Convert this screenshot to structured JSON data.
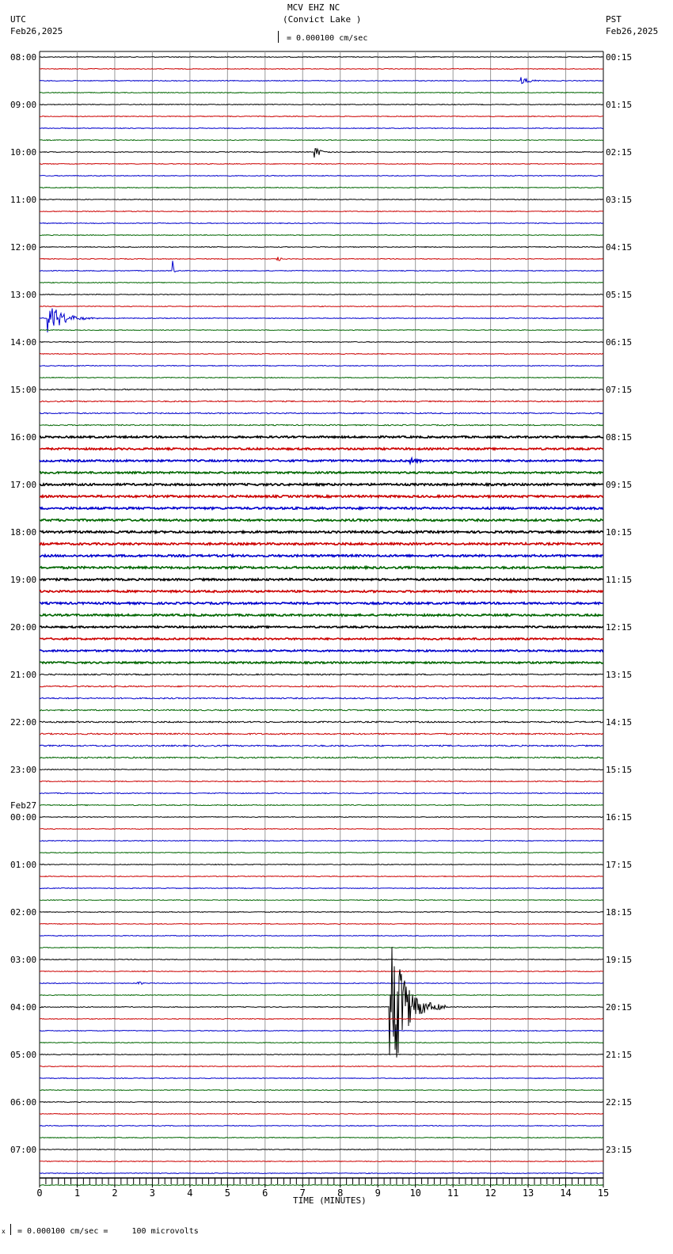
{
  "header": {
    "station": "MCV EHZ NC",
    "location": "(Convict Lake )",
    "scale": "= 0.000100 cm/sec",
    "left_tz": "UTC",
    "left_date": "Feb26,2025",
    "right_tz": "PST",
    "right_date": "Feb26,2025"
  },
  "footer": {
    "scale_note": "= 0.000100 cm/sec =     100 microvolts",
    "prefix": "x"
  },
  "chart_data": {
    "type": "line",
    "title": "MCV EHZ NC (Convict Lake )",
    "xlabel": "TIME (MINUTES)",
    "xlim": [
      0,
      15
    ],
    "x_ticks": [
      "0",
      "1",
      "2",
      "3",
      "4",
      "5",
      "6",
      "7",
      "8",
      "9",
      "10",
      "11",
      "12",
      "13",
      "14",
      "15"
    ],
    "traces_per_hour": 4,
    "trace_colors": [
      "#000000",
      "#cc0000",
      "#0000cc",
      "#006600"
    ],
    "left_labels": [
      "08:00",
      "09:00",
      "10:00",
      "11:00",
      "12:00",
      "13:00",
      "14:00",
      "15:00",
      "16:00",
      "17:00",
      "18:00",
      "19:00",
      "20:00",
      "21:00",
      "22:00",
      "23:00",
      "00:00",
      "01:00",
      "02:00",
      "03:00",
      "04:00",
      "05:00",
      "06:00",
      "07:00"
    ],
    "date_change_label": "Feb27",
    "right_labels": [
      "00:15",
      "01:15",
      "02:15",
      "03:15",
      "04:15",
      "05:15",
      "06:15",
      "07:15",
      "08:15",
      "09:15",
      "10:15",
      "11:15",
      "12:15",
      "13:15",
      "14:15",
      "15:15",
      "16:15",
      "17:15",
      "18:15",
      "19:15",
      "20:15",
      "21:15",
      "22:15",
      "23:15"
    ],
    "noise_by_hour": [
      0.6,
      0.6,
      0.6,
      0.6,
      0.6,
      0.6,
      0.6,
      0.9,
      1.4,
      1.6,
      1.6,
      1.5,
      1.3,
      1.0,
      1.1,
      0.7,
      0.6,
      0.6,
      0.6,
      0.6,
      0.6,
      0.6,
      0.6,
      0.6
    ],
    "events": [
      {
        "trace": 2,
        "start": 12.8,
        "end": 13.6,
        "amplitude": 0.4
      },
      {
        "trace": 8,
        "start": 7.3,
        "end": 7.9,
        "amplitude": 0.6
      },
      {
        "trace": 17,
        "start": 6.3,
        "end": 6.7,
        "amplitude": 0.35
      },
      {
        "trace": 18,
        "start": 3.52,
        "end": 3.64,
        "amplitude": 1.9
      },
      {
        "trace": 22,
        "start": 0.2,
        "end": 1.6,
        "amplitude": 1.6
      },
      {
        "trace": 34,
        "start": 9.8,
        "end": 11.0,
        "amplitude": 0.25
      },
      {
        "trace": 78,
        "start": 2.6,
        "end": 3.2,
        "amplitude": 0.2
      },
      {
        "trace": 80,
        "start": 9.3,
        "end": 10.8,
        "amplitude": 7.5
      }
    ]
  }
}
